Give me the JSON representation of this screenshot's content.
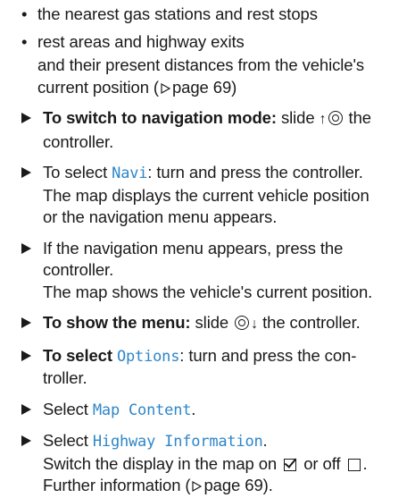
{
  "bullets": [
    "the nearest gas stations and rest stops",
    "rest areas and highway exits"
  ],
  "bullet_continuation": {
    "line1": "and their present distances from the vehicle's",
    "line2_prefix": "current position (",
    "line2_ref": "page 69",
    "line2_suffix": ")"
  },
  "steps": {
    "navigation_mode": {
      "bold": "To switch to navigation mode:",
      "text_a": "slide",
      "text_b": "the",
      "line2": "controller."
    },
    "select_navi": {
      "prefix": "To select",
      "menu": "Navi",
      "suffix": ": turn and press the controller.",
      "line2": "The map displays the current vehicle position",
      "line3": "or the navigation menu appears."
    },
    "nav_menu_appears": {
      "line1": "If the navigation menu appears, press the",
      "line2": "controller.",
      "line3": "The map shows the vehicle's current position."
    },
    "show_menu": {
      "bold": "To show the menu:",
      "text_a": "slide",
      "text_b": "the controller."
    },
    "select_options": {
      "bold_prefix": "To select",
      "menu": "Options",
      "suffix": ": turn and press the con-",
      "line2": "troller."
    },
    "select_map_content": {
      "prefix": "Select",
      "menu": "Map Content",
      "suffix": "."
    },
    "select_highway_info": {
      "prefix": "Select",
      "menu": "Highway Information",
      "suffix": ".",
      "line2_prefix": "Switch the display in the map on",
      "line2_mid": "or off",
      "line2_suffix": ".",
      "line3_prefix": "Further information (",
      "line3_ref": "page 69",
      "line3_suffix": ")."
    }
  },
  "colors": {
    "text": "#1a1a1a",
    "menu_item": "#2e86c8"
  },
  "icons": [
    "bullet-dot",
    "step-arrow-icon",
    "page-ref-icon",
    "controller-icon",
    "slide-up-arrow-icon",
    "slide-down-arrow-icon",
    "checkbox-checked-icon",
    "checkbox-unchecked-icon"
  ]
}
